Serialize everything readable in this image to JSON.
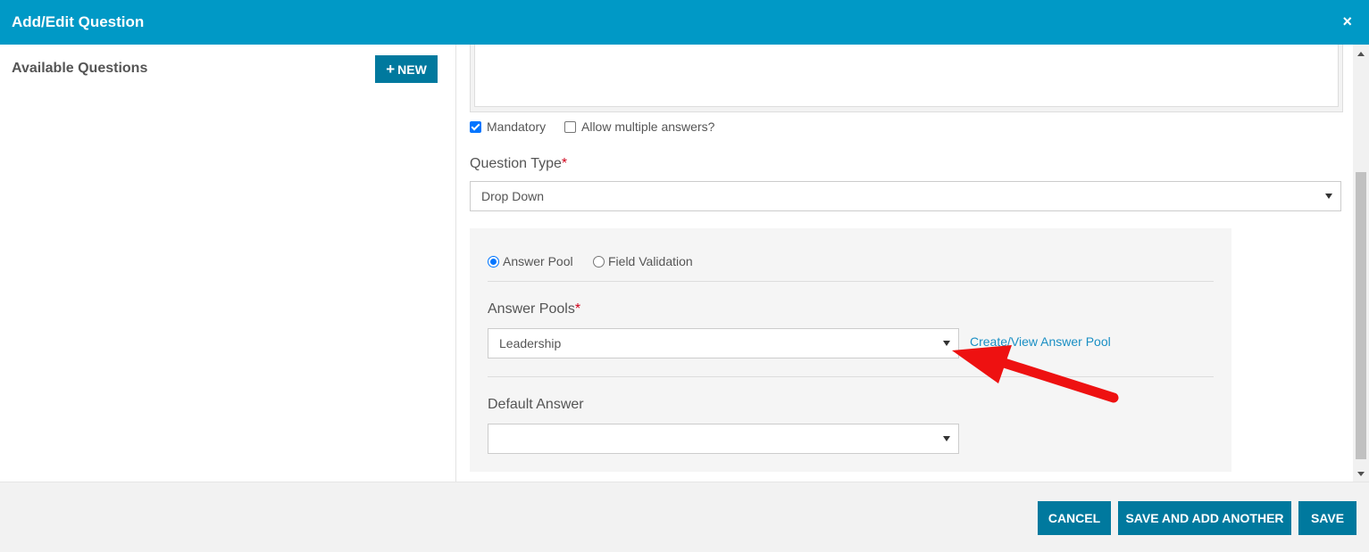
{
  "dialog": {
    "title": "Add/Edit Question",
    "close_label": "×"
  },
  "left_pane": {
    "heading": "Available Questions",
    "new_button": {
      "icon": "+",
      "label": "NEW"
    }
  },
  "form": {
    "mandatory": {
      "label": "Mandatory",
      "checked": true
    },
    "allow_multiple": {
      "label": "Allow multiple answers?",
      "checked": false
    },
    "question_type": {
      "label": "Question Type",
      "required_mark": "*",
      "value": "Drop Down"
    },
    "answer_source": {
      "options": [
        {
          "label": "Answer Pool",
          "selected": true
        },
        {
          "label": "Field Validation",
          "selected": false
        }
      ]
    },
    "answer_pools": {
      "label": "Answer Pools",
      "required_mark": "*",
      "value": "Leadership",
      "link": "Create/View Answer Pool"
    },
    "default_answer": {
      "label": "Default Answer",
      "value": ""
    }
  },
  "footer": {
    "cancel": "CANCEL",
    "save_and_add": "SAVE AND ADD ANOTHER",
    "save": "SAVE"
  },
  "colors": {
    "header": "#0099c6",
    "button": "#00799e",
    "link": "#1a8fc4",
    "annotation_arrow": "#ee1111",
    "required": "#d0021b"
  },
  "icons": {
    "close": "close-icon",
    "dropdown": "chevron-down-icon",
    "annotation": "red-arrow-icon"
  }
}
